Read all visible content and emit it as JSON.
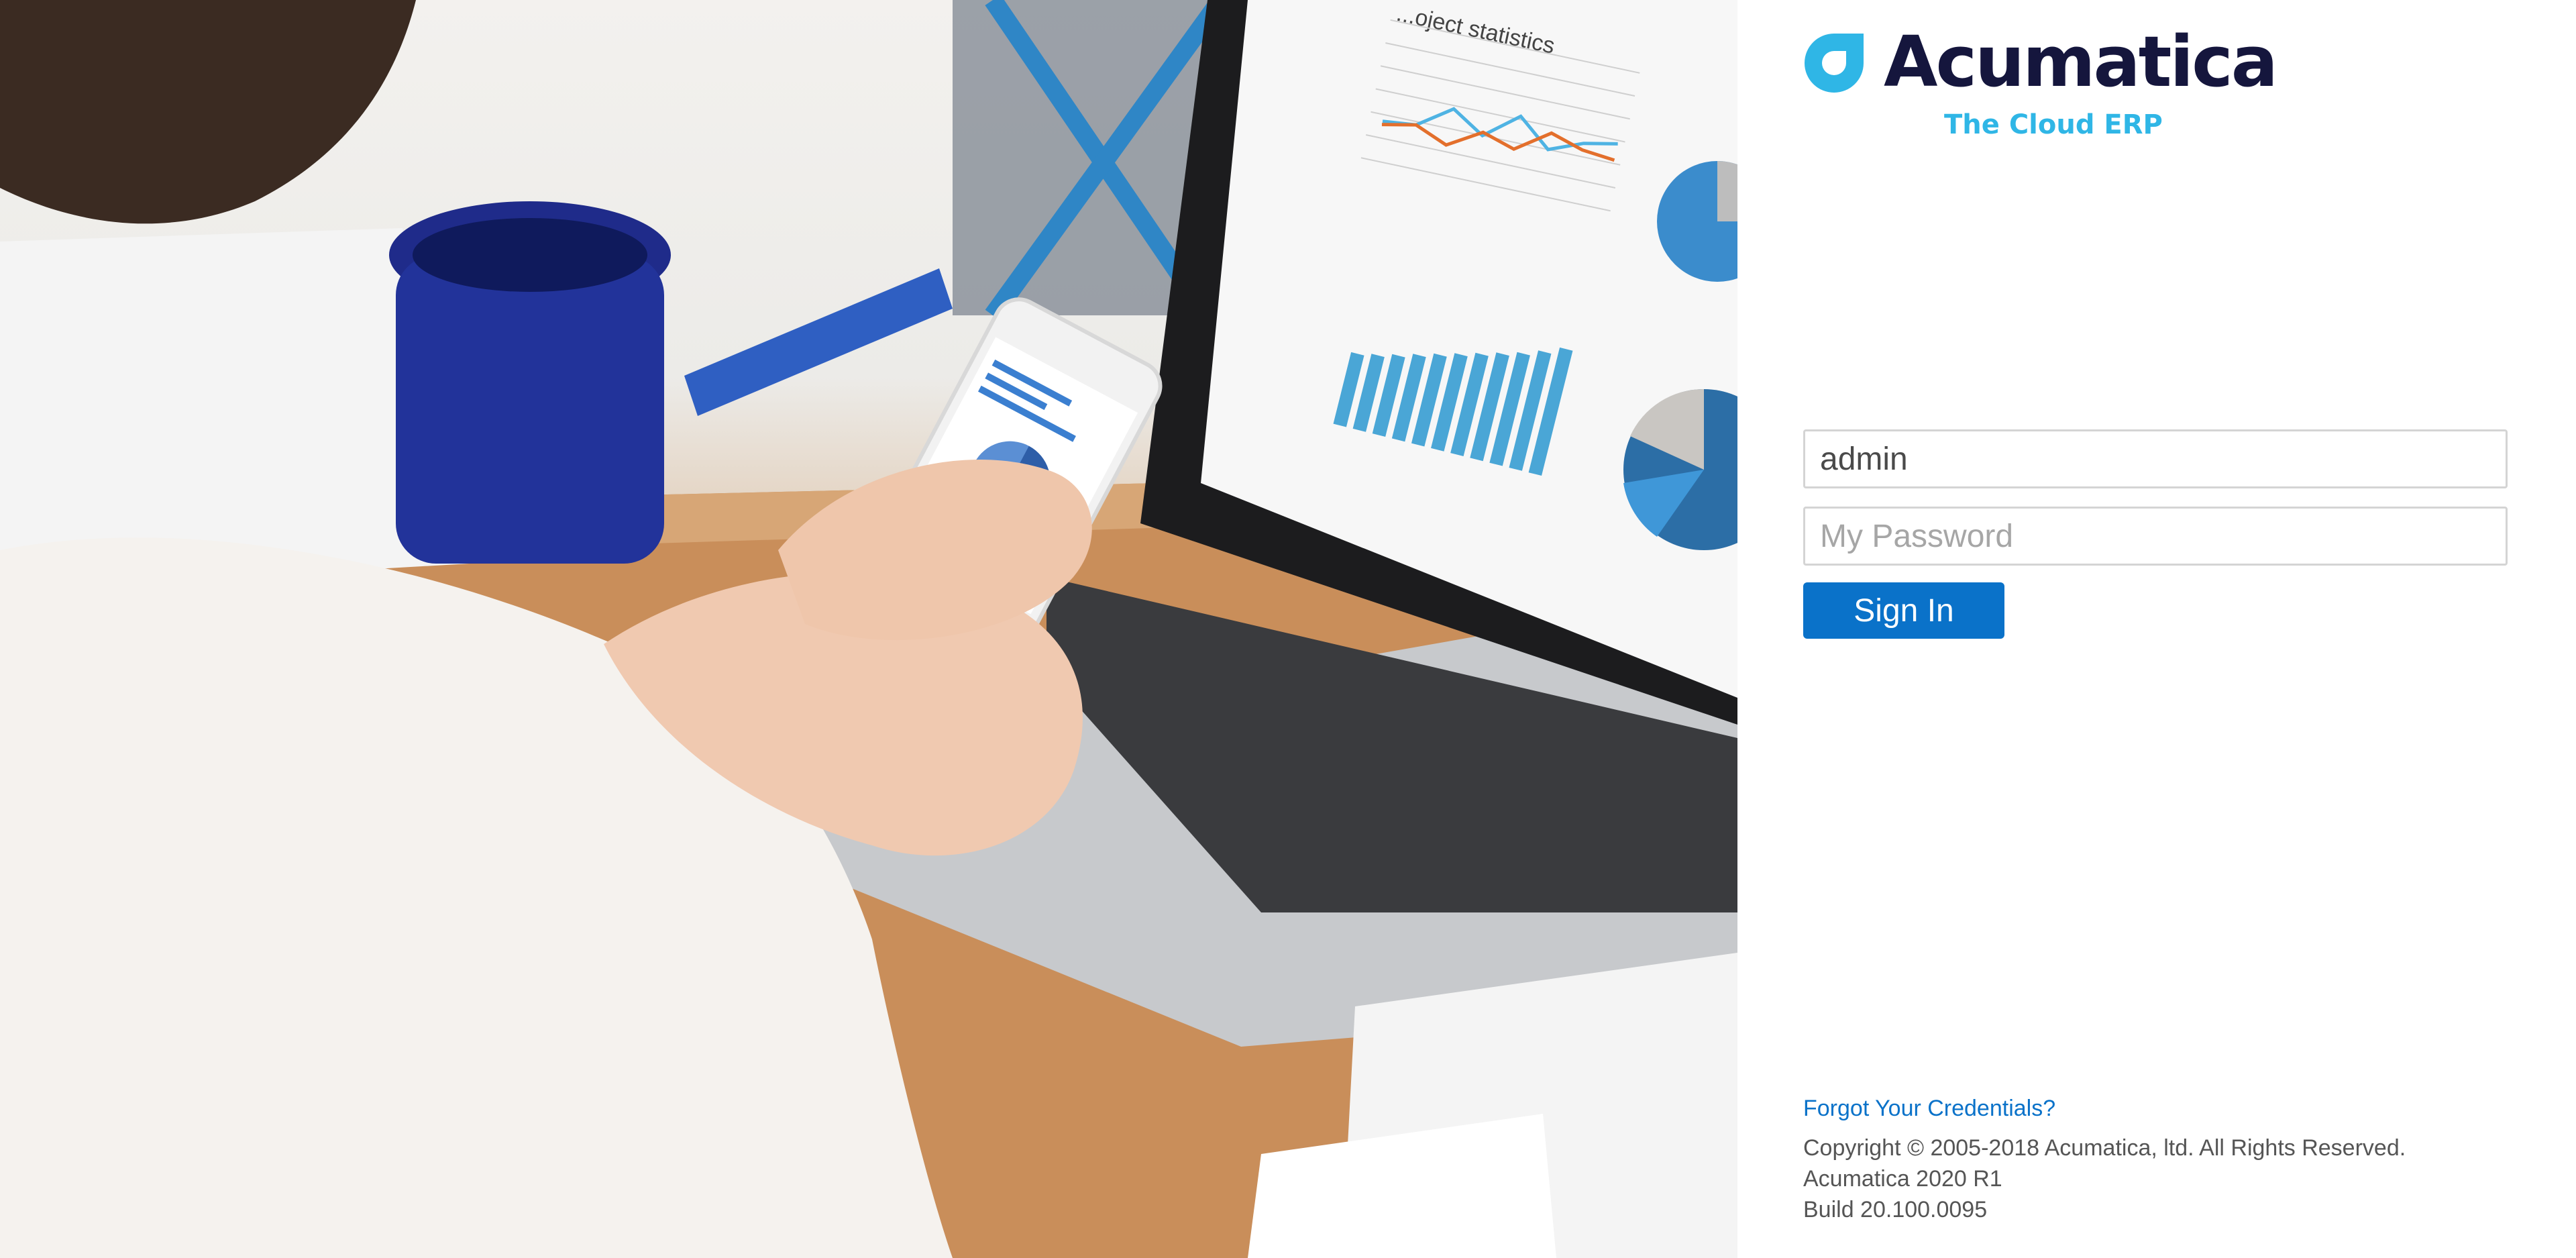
{
  "brand": {
    "name": "Acumatica",
    "tagline": "The Cloud ERP",
    "colors": {
      "wordmark": "#15163d",
      "accent": "#2fb6e6",
      "primary": "#0a72c9"
    }
  },
  "hero": {
    "laptop_chart_title": "...oject statistics",
    "icon": "photo-illustration"
  },
  "login": {
    "username_value": "admin",
    "password_placeholder": "My Password",
    "sign_in_label": "Sign In"
  },
  "footer": {
    "forgot_link": "Forgot Your Credentials?",
    "copyright": "Copyright © 2005-2018 Acumatica, ltd. All Rights Reserved.",
    "version": "Acumatica 2020 R1",
    "build": "Build 20.100.0095"
  }
}
